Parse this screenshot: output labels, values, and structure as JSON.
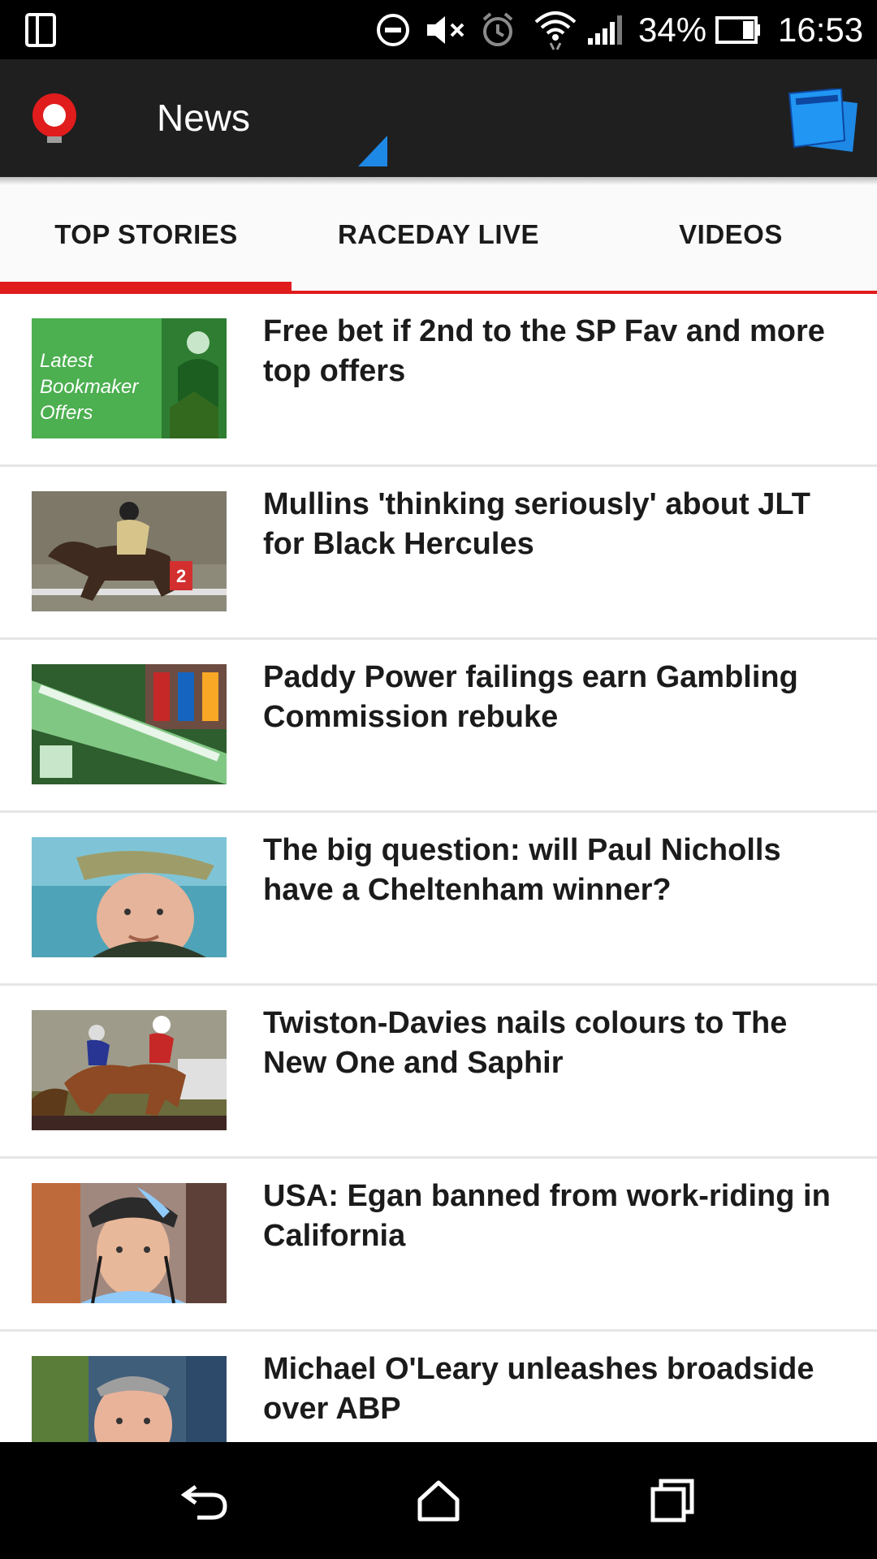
{
  "status_bar": {
    "battery_percent": "34%",
    "time": "16:53",
    "icons": [
      "tablet-mode-icon",
      "do-not-disturb-icon",
      "volume-mute-icon",
      "alarm-icon",
      "wifi-icon",
      "signal-icon",
      "battery-icon"
    ]
  },
  "app_bar": {
    "title": "News",
    "logo": "racing-post-logo-icon",
    "action_icon": "digital-newspaper-icon",
    "accent_color": "#1e88e5"
  },
  "tabs": [
    {
      "label": "TOP STORIES",
      "selected": true
    },
    {
      "label": "RACEDAY LIVE",
      "selected": false
    },
    {
      "label": "VIDEOS",
      "selected": false
    }
  ],
  "tab_indicator_color": "#e01c1c",
  "articles": [
    {
      "headline": "Free bet if 2nd to the SP Fav and more top offers",
      "thumb_text": [
        "Latest",
        "Bookmaker",
        "Offers"
      ]
    },
    {
      "headline": "Mullins 'thinking seriously' about JLT for Black Hercules"
    },
    {
      "headline": "Paddy Power failings earn Gambling Commission rebuke"
    },
    {
      "headline": "The big question: will Paul Nicholls have a Cheltenham winner?"
    },
    {
      "headline": "Twiston-Davies nails colours to The New One and Saphir"
    },
    {
      "headline": "USA: Egan banned from work-riding in California"
    },
    {
      "headline": "Michael O'Leary unleashes broadside over ABP"
    }
  ],
  "nav_bar": {
    "buttons": [
      "back-icon",
      "home-icon",
      "recents-icon"
    ]
  }
}
